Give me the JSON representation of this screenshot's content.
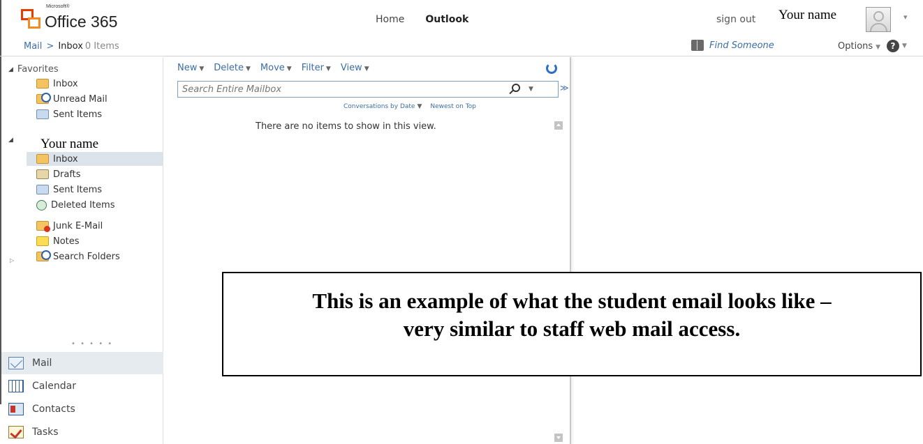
{
  "header": {
    "logo_small": "Microsoft®",
    "logo_name": "Office 365",
    "nav": {
      "home": "Home",
      "outlook": "Outlook"
    },
    "sign_out": "sign out",
    "user_name": "Your name"
  },
  "breadcrumb": {
    "mail": "Mail",
    "separator": ">",
    "inbox": "Inbox",
    "count": "0 Items",
    "find_someone": "Find Someone",
    "options": "Options"
  },
  "sidebar": {
    "favorites": {
      "label": "Favorites",
      "items": [
        {
          "label": "Inbox",
          "icon": "inbox-folder-icon"
        },
        {
          "label": "Unread Mail",
          "icon": "search-folder-icon"
        },
        {
          "label": "Sent Items",
          "icon": "sent-items-icon"
        }
      ]
    },
    "mailbox": {
      "label": "Your name",
      "items": [
        {
          "label": "Inbox",
          "icon": "inbox-folder-icon"
        },
        {
          "label": "Drafts",
          "icon": "drafts-icon"
        },
        {
          "label": "Sent Items",
          "icon": "sent-items-icon"
        },
        {
          "label": "Deleted Items",
          "icon": "deleted-items-icon"
        },
        {
          "label": "Junk E-Mail",
          "icon": "junk-mail-icon"
        },
        {
          "label": "Notes",
          "icon": "notes-icon"
        },
        {
          "label": "Search Folders",
          "icon": "search-folder-icon"
        }
      ]
    },
    "grip": "• • • • •",
    "nav_buttons": [
      {
        "label": "Mail",
        "icon": "mail-icon"
      },
      {
        "label": "Calendar",
        "icon": "calendar-icon"
      },
      {
        "label": "Contacts",
        "icon": "contacts-icon"
      },
      {
        "label": "Tasks",
        "icon": "tasks-icon"
      }
    ]
  },
  "list": {
    "toolbar": {
      "new": "New",
      "delete": "Delete",
      "move": "Move",
      "filter": "Filter",
      "view": "View"
    },
    "search_placeholder": "Search Entire Mailbox",
    "sort": {
      "arrange": "Conversations by Date",
      "order": "Newest on Top"
    },
    "empty_message": "There are no items to show in this view."
  },
  "callout": {
    "line1": "This is an example of what the student email looks like –",
    "line2": "very similar to staff web mail access."
  }
}
